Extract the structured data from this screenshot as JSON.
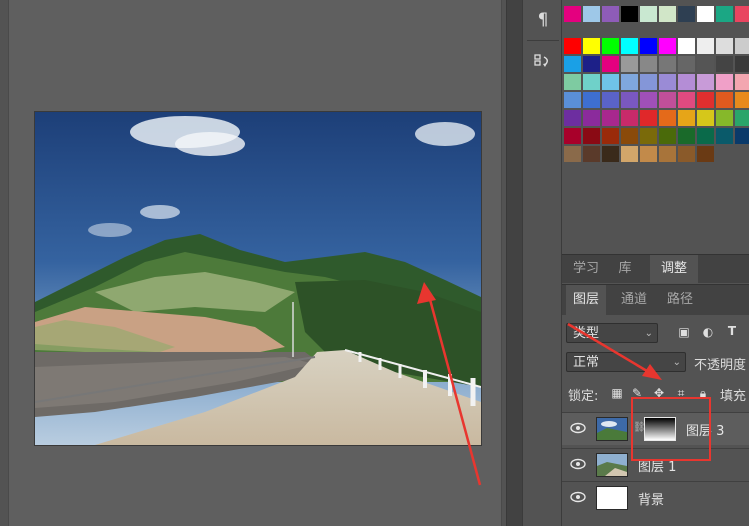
{
  "side_tools": {
    "paragraph_glyph": "¶",
    "history_glyph": "⤿"
  },
  "panel_tabs_top": [
    "学习",
    "库",
    "调整"
  ],
  "panel_tabs_layers": [
    "图层",
    "通道",
    "路径"
  ],
  "layers_panel": {
    "filter_label": "类型",
    "blend_mode": "正常",
    "opacity_label": "不透明度",
    "lock_label": "锁定:",
    "fill_label": "填充"
  },
  "layers": [
    {
      "name": "图层 3",
      "selected": true,
      "has_mask": true
    },
    {
      "name": "图层 1",
      "selected": false,
      "has_mask": false
    },
    {
      "name": "背景",
      "selected": false,
      "has_mask": false
    }
  ],
  "swatch_rows": [
    [
      "#e4007f",
      "#9ec8e8",
      "#8e5cb8",
      "#000000",
      "#c9e8d1",
      "#d1e6c8",
      "#2e3f52",
      "#ffffff",
      "#1ba784",
      "#e94560"
    ],
    [
      "#ff0000",
      "#ffff00",
      "#00ff00",
      "#00ffff",
      "#0000ff",
      "#ff00ff",
      "#ffffff",
      "#eeeeee",
      "#dddddd",
      "#cccccc"
    ],
    [
      "#1aa0e6",
      "#1d2088",
      "#e4007f",
      "#9a9a9a",
      "#888888",
      "#777777",
      "#666666",
      "#555555",
      "#444444",
      "#3a3a3a"
    ],
    [
      "#7ecba1",
      "#6fd1c9",
      "#6fc3e8",
      "#7fa7dd",
      "#8496d8",
      "#9a8bd6",
      "#b48dd6",
      "#c89bd8",
      "#f0a0c8",
      "#f3a6b0"
    ],
    [
      "#5a8fd8",
      "#3e6fd0",
      "#5a63c9",
      "#7a58c0",
      "#a050b8",
      "#c04f9a",
      "#e04a80",
      "#e02f2f",
      "#e05a1f",
      "#e88a1c"
    ],
    [
      "#6d2ea0",
      "#8b2b9c",
      "#a8288e",
      "#c82a6a",
      "#e0282a",
      "#e46a1a",
      "#e6a518",
      "#d6c71a",
      "#86b82a",
      "#2aa56a"
    ],
    [
      "#a8002a",
      "#8a0a14",
      "#9a2a0a",
      "#8a4a0a",
      "#7a6a0a",
      "#4a6a0a",
      "#1a6a2a",
      "#0a6a4a",
      "#0a5a6a",
      "#0a3a6a"
    ],
    [
      "#8a6a4a",
      "#5a3a2a",
      "#3a2a1a",
      "#d2a66a",
      "#c28a4a",
      "#a8743a",
      "#8a5a2a",
      "#6a3a14"
    ]
  ]
}
